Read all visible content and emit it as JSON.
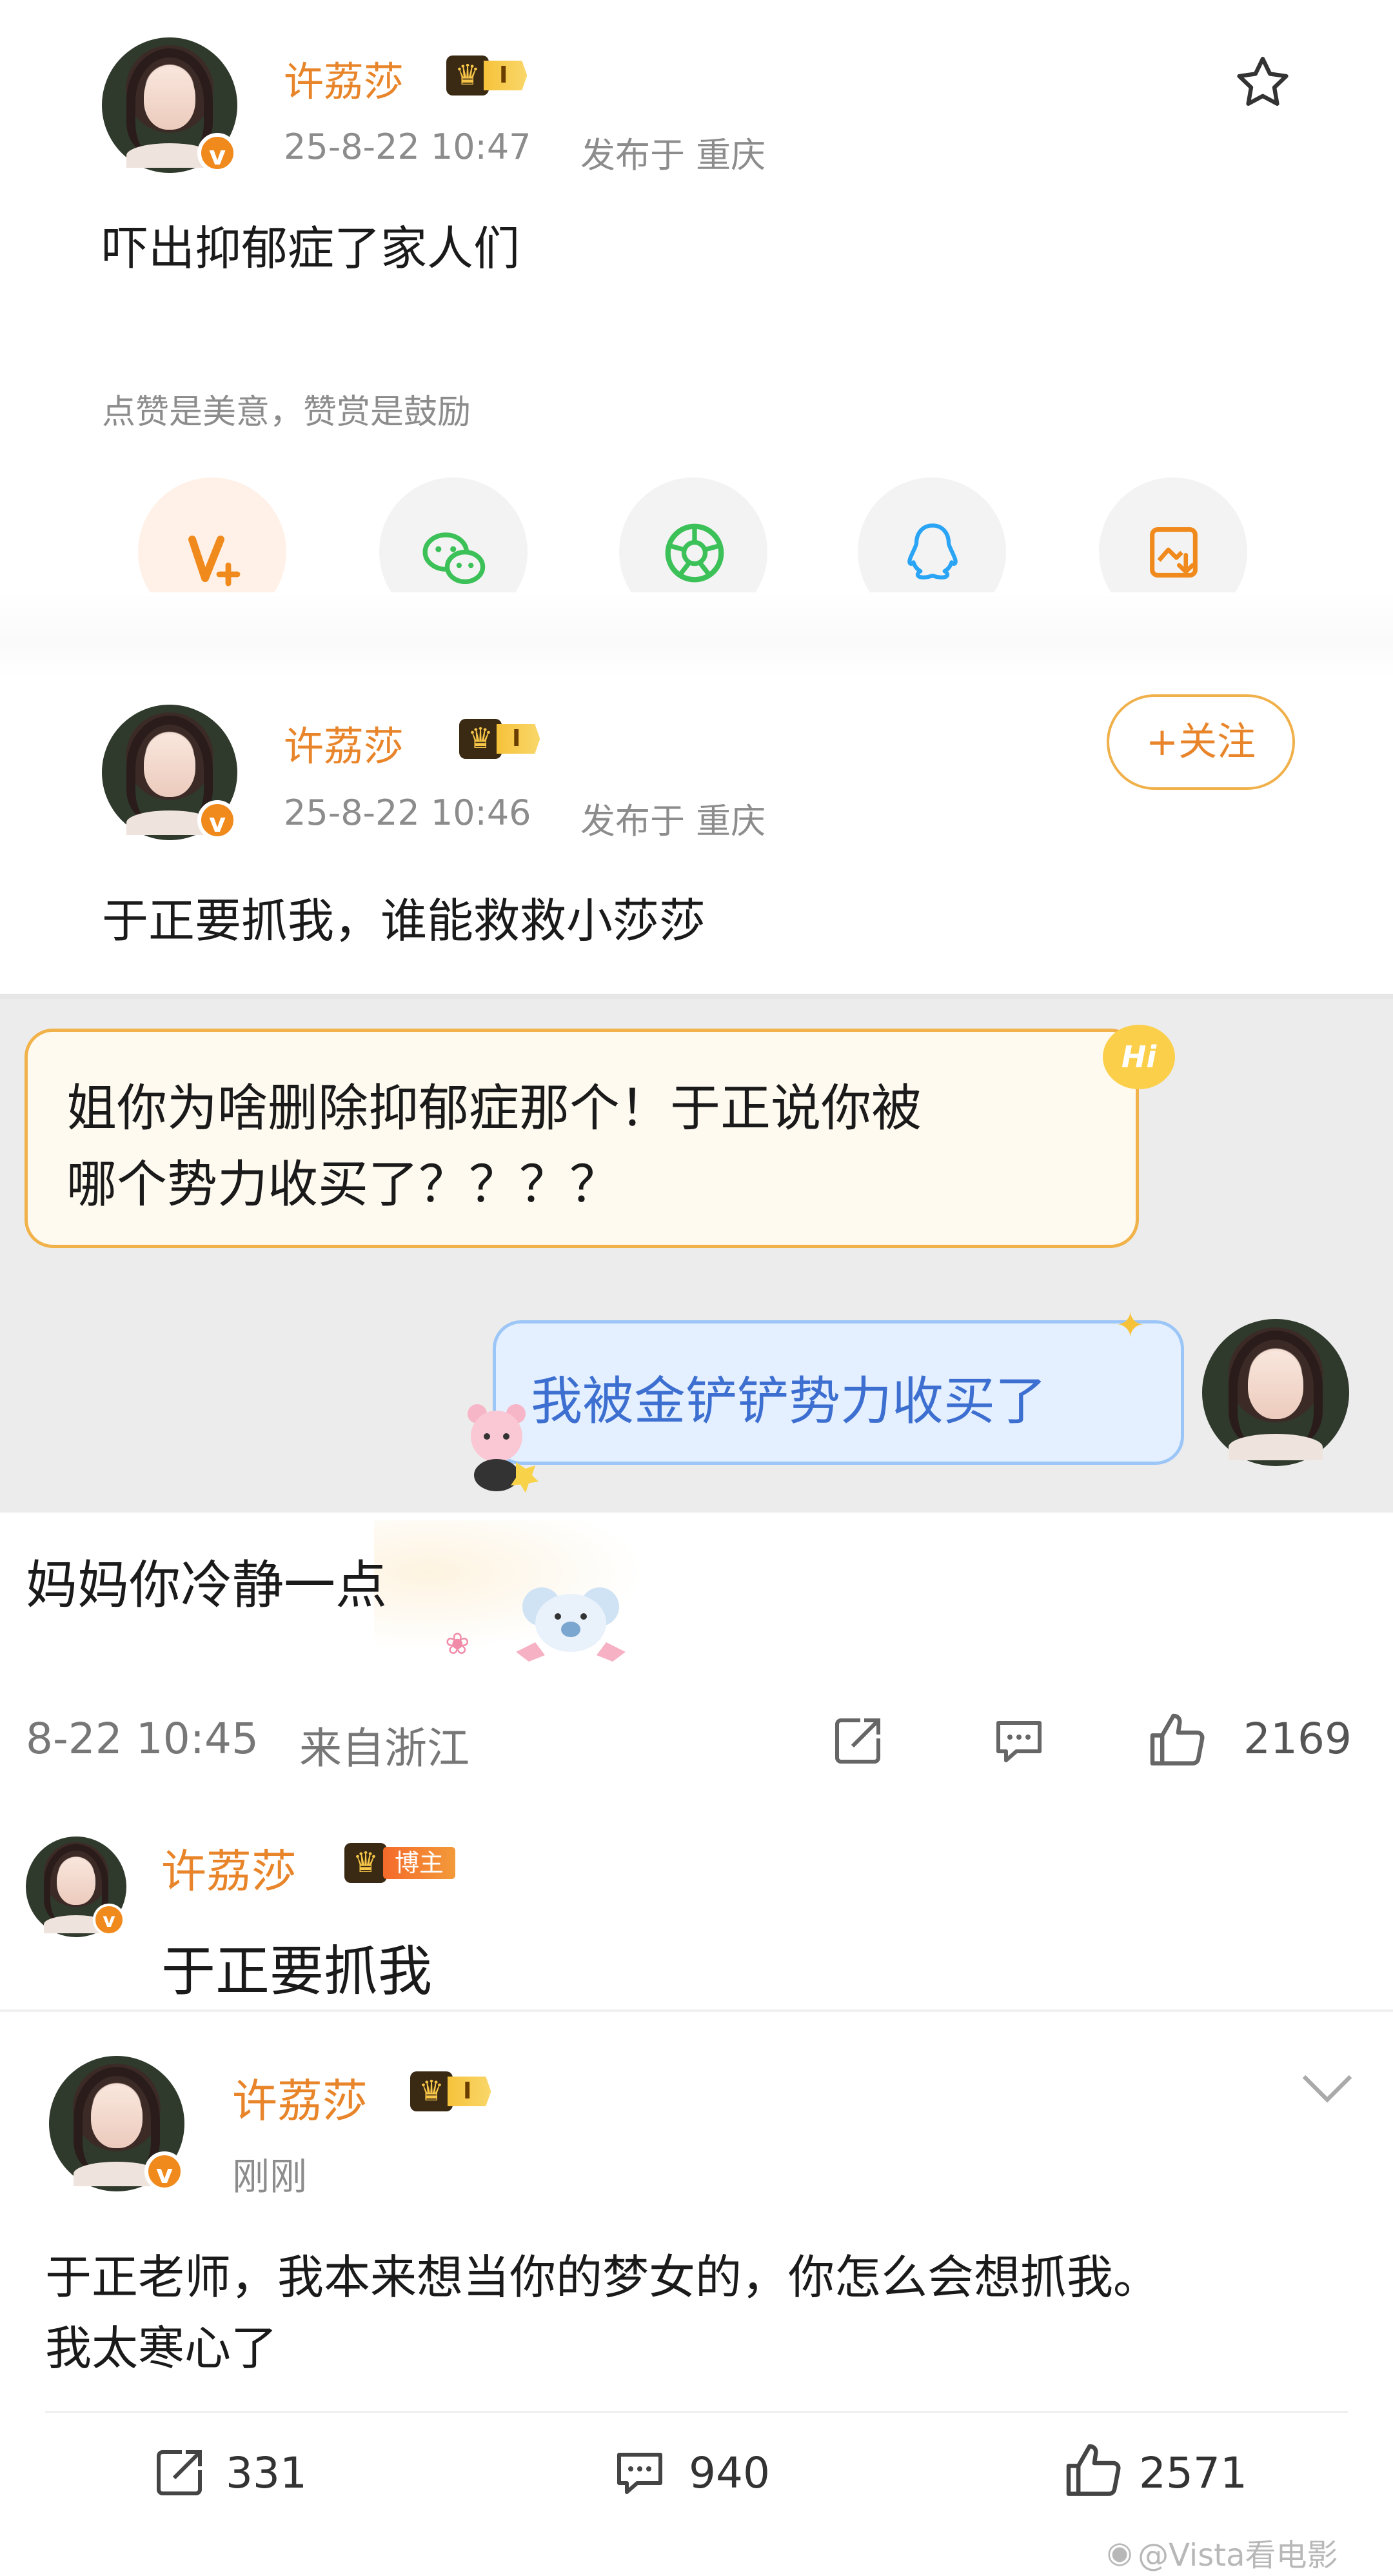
{
  "post1": {
    "name": "许荔莎",
    "level": "I",
    "time": "25-8-22 10:47",
    "location": "发布于 重庆",
    "text": "吓出抑郁症了家人们",
    "reward_tip": "点赞是美意，赞赏是鼓励",
    "star_icon": "star-outline-icon",
    "share_icons": [
      "v-plus-icon",
      "wechat-icon",
      "moments-icon",
      "qq-icon",
      "save-image-icon"
    ]
  },
  "post2": {
    "name": "许荔莎",
    "level": "I",
    "time": "25-8-22 10:46",
    "location": "发布于 重庆",
    "follow_label": "+关注",
    "text": "于正要抓我，谁能救救小莎莎"
  },
  "chat": {
    "incoming": "姐你为啥删除抑郁症那个！于正说你被哪个势力收买了？？？？",
    "incoming_line1": "姐你为啥删除抑郁症那个！于正说你被",
    "incoming_line2": "哪个势力收买了？？？？",
    "hi_badge": "Hi",
    "outgoing": "我被金铲铲势力收买了"
  },
  "comment": {
    "text": "妈妈你冷静一点",
    "time": "8-22 10:45",
    "location": "来自浙江",
    "likes": "2169"
  },
  "reply": {
    "name": "许荔莎",
    "badge": "博主",
    "text": "于正要抓我"
  },
  "post3": {
    "name": "许荔莎",
    "level": "I",
    "time": "刚刚",
    "text_line1": "于正老师，我本来想当你的梦女的，你怎么会想抓我。",
    "text_line2": "我太寒心了",
    "reposts": "331",
    "comments": "940",
    "likes": "2571"
  },
  "watermark": "@Vista看电影",
  "colors": {
    "name_orange": "#e8852a",
    "gray_text": "#8c8c8c",
    "incoming_bubble_border": "#f2b24a",
    "outgoing_bubble": "#e4f0ff",
    "outgoing_text": "#3d6fd1"
  }
}
